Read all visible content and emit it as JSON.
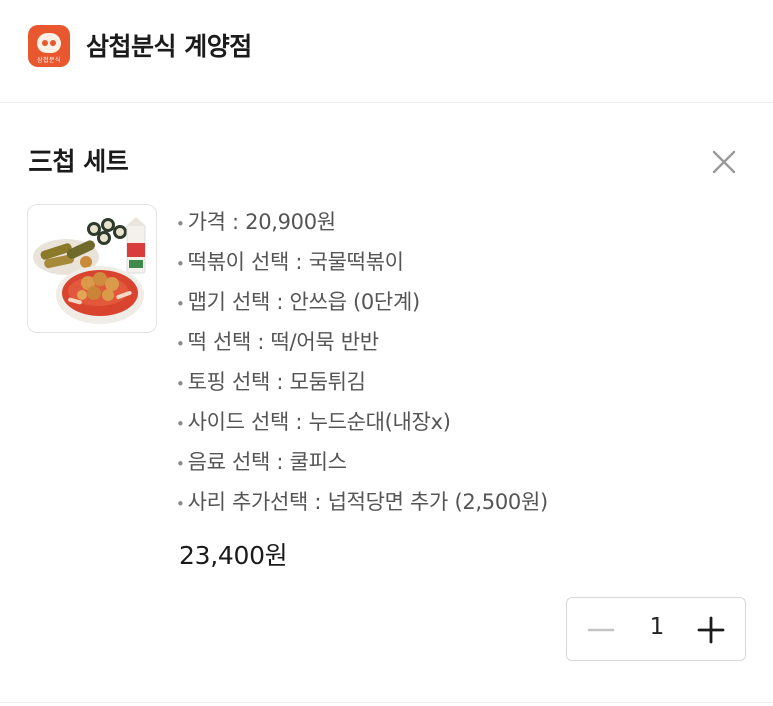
{
  "header": {
    "store_name": "삼첩분식 계양점",
    "logo_text": "삼첩분식",
    "logo_color": "#e8572e"
  },
  "menu": {
    "title": "三첩 세트",
    "close_icon": "close-icon",
    "options": [
      "가격 : 20,900원",
      "떡볶이 선택 : 국물떡볶이",
      "맵기 선택 : 안쓰읍 (0단계)",
      "떡 선택 : 떡/어묵 반반",
      "토핑 선택 : 모둠튀김",
      "사이드 선택 : 누드순대(내장x)",
      "음료 선택 : 쿨피스",
      "사리 추가선택 : 넙적당면 추가 (2,500원)"
    ],
    "total_price": "23,400원"
  },
  "quantity": {
    "value": "1",
    "minus_icon": "minus-icon",
    "plus_icon": "plus-icon"
  }
}
